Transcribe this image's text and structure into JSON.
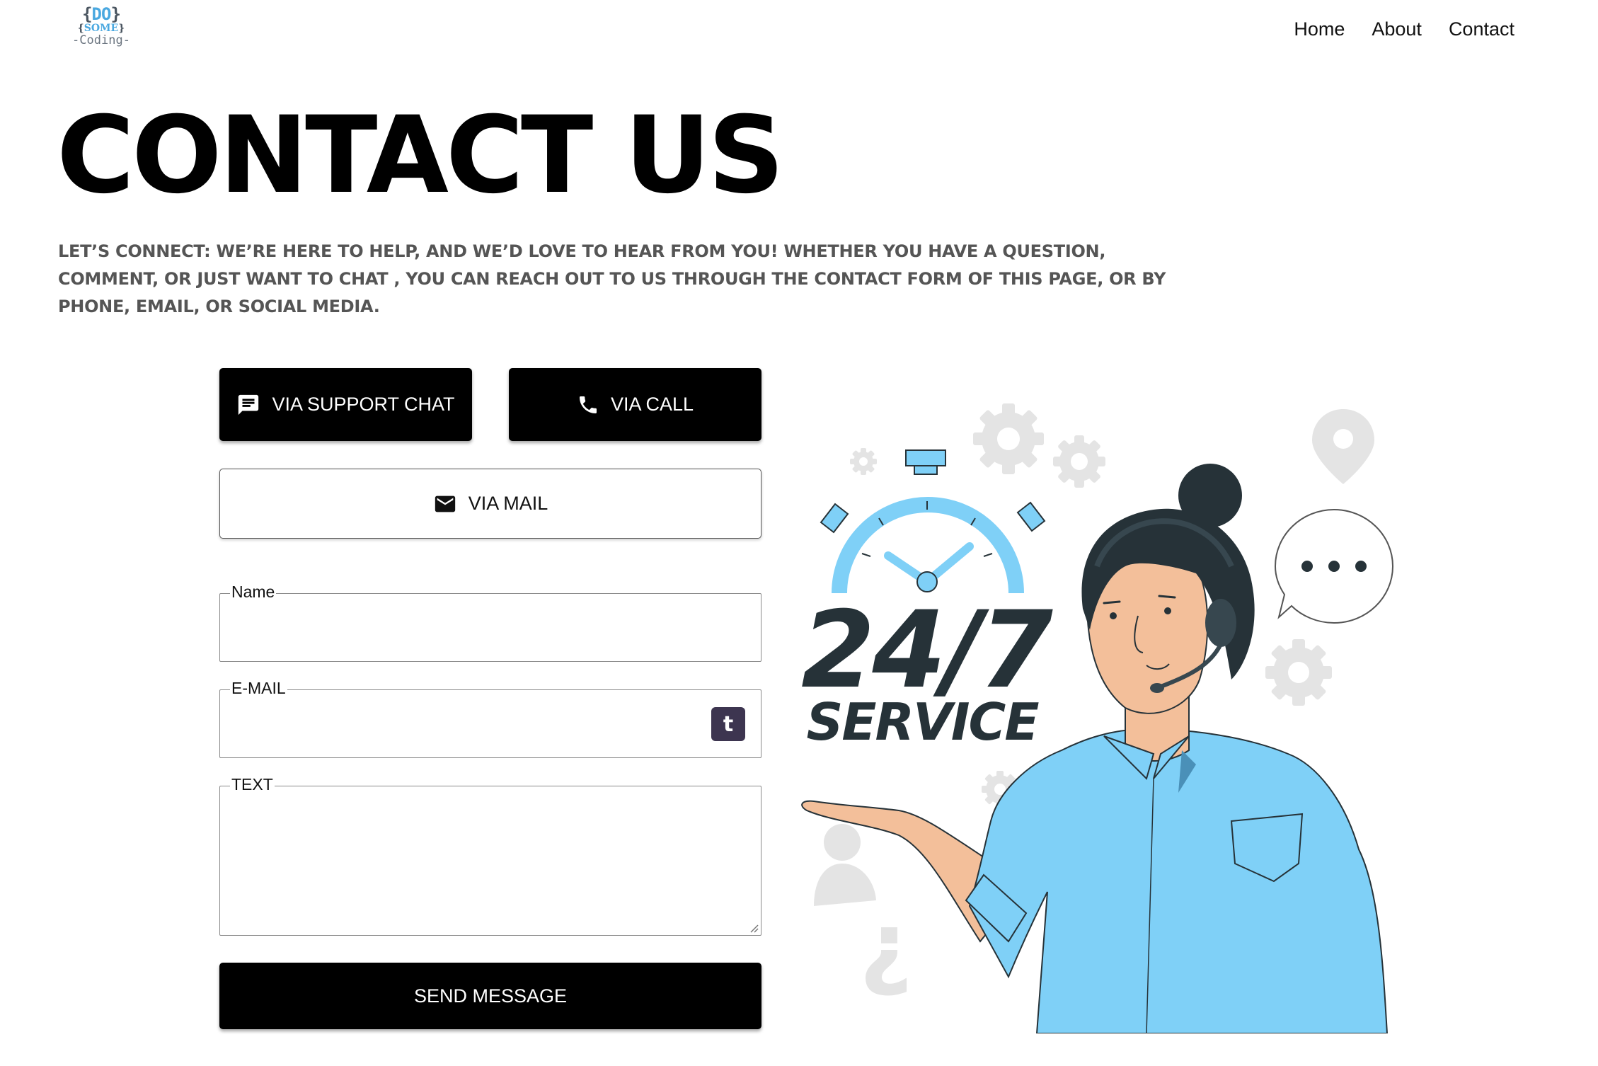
{
  "header": {
    "logo": {
      "line1_brace_open": "{",
      "line1_text": "DO",
      "line1_brace_close": "}",
      "line2_brace_open": "{",
      "line2_text": "SOME",
      "line2_brace_close": "}",
      "line3": "-Coding-"
    },
    "nav": [
      {
        "label": "Home"
      },
      {
        "label": "About"
      },
      {
        "label": "Contact"
      }
    ]
  },
  "hero": {
    "title": "CONTACT US",
    "lead": "LET’S CONNECT: WE’RE HERE TO HELP, AND WE’D LOVE TO HEAR FROM YOU! WHETHER YOU HAVE A QUESTION, COMMENT, OR JUST WANT TO CHAT , YOU CAN REACH OUT TO US THROUGH THE CONTACT FORM OF THIS PAGE, OR BY PHONE, EMAIL, OR SOCIAL MEDIA."
  },
  "contact_options": {
    "chat": {
      "label": "VIA SUPPORT CHAT",
      "icon": "chat-bubble-icon"
    },
    "call": {
      "label": "VIA CALL",
      "icon": "phone-icon"
    },
    "mail": {
      "label": "VIA MAIL",
      "icon": "envelope-icon"
    }
  },
  "form": {
    "name": {
      "label": "Name",
      "value": ""
    },
    "email": {
      "label": "E-MAIL",
      "value": "",
      "badge": "t"
    },
    "text": {
      "label": "TEXT",
      "value": ""
    },
    "submit_label": "SEND MESSAGE"
  },
  "illustration": {
    "headline": "24/7",
    "subline": "SERVICE"
  },
  "colors": {
    "accent_blue": "#7fd0f7",
    "dark_button": "#000000",
    "lead_text": "#555555",
    "illustration_dark": "#263238"
  }
}
